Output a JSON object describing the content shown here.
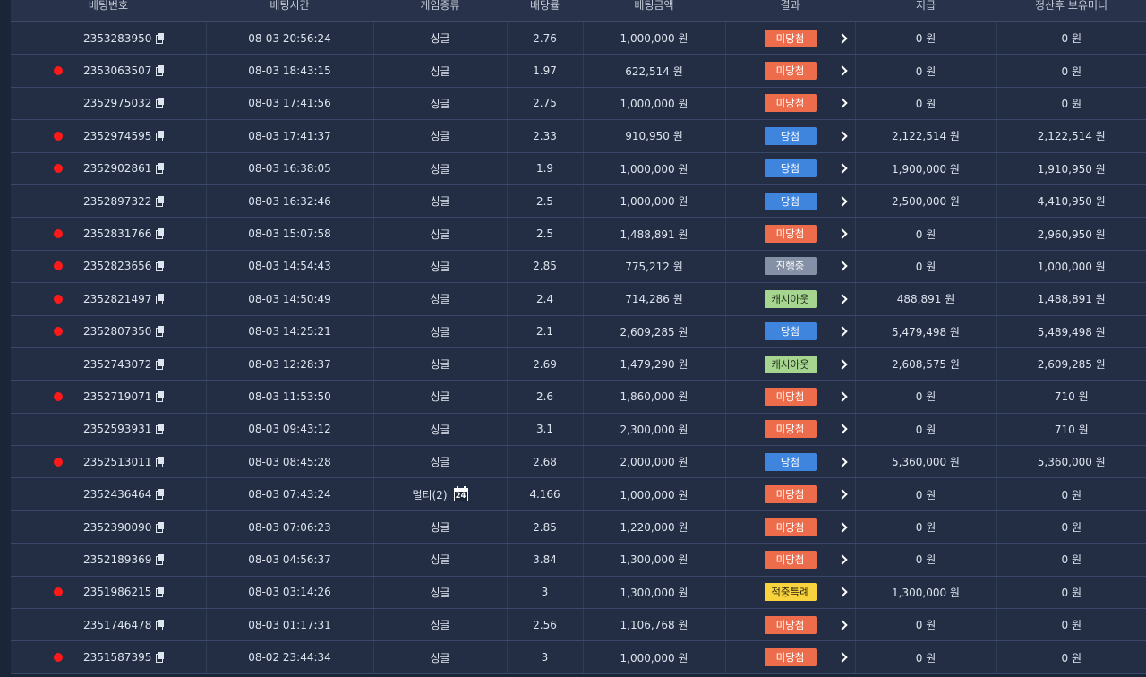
{
  "headers": [
    "베팅번호",
    "베팅시간",
    "게임종류",
    "배당률",
    "베팅금액",
    "결과",
    "지급",
    "정산후 보유머니"
  ],
  "rows": [
    {
      "id": "2353283950",
      "dot": false,
      "time": "08-03 20:56:24",
      "type": "싱글",
      "odds": "2.76",
      "amount": "1,000,000 원",
      "result": "미당첨",
      "rclass": "b-miss",
      "payout": "0 원",
      "balance": "0 원"
    },
    {
      "id": "2353063507",
      "dot": true,
      "time": "08-03 18:43:15",
      "type": "싱글",
      "odds": "1.97",
      "amount": "622,514 원",
      "result": "미당첨",
      "rclass": "b-miss",
      "payout": "0 원",
      "balance": "0 원"
    },
    {
      "id": "2352975032",
      "dot": false,
      "time": "08-03 17:41:56",
      "type": "싱글",
      "odds": "2.75",
      "amount": "1,000,000 원",
      "result": "미당첨",
      "rclass": "b-miss",
      "payout": "0 원",
      "balance": "0 원"
    },
    {
      "id": "2352974595",
      "dot": true,
      "time": "08-03 17:41:37",
      "type": "싱글",
      "odds": "2.33",
      "amount": "910,950 원",
      "result": "당첨",
      "rclass": "b-win",
      "payout": "2,122,514 원",
      "balance": "2,122,514 원"
    },
    {
      "id": "2352902861",
      "dot": true,
      "time": "08-03 16:38:05",
      "type": "싱글",
      "odds": "1.9",
      "amount": "1,000,000 원",
      "result": "당첨",
      "rclass": "b-win",
      "payout": "1,900,000 원",
      "balance": "1,910,950 원"
    },
    {
      "id": "2352897322",
      "dot": false,
      "time": "08-03 16:32:46",
      "type": "싱글",
      "odds": "2.5",
      "amount": "1,000,000 원",
      "result": "당첨",
      "rclass": "b-win",
      "payout": "2,500,000 원",
      "balance": "4,410,950 원"
    },
    {
      "id": "2352831766",
      "dot": true,
      "time": "08-03 15:07:58",
      "type": "싱글",
      "odds": "2.5",
      "amount": "1,488,891 원",
      "result": "미당첨",
      "rclass": "b-miss",
      "payout": "0 원",
      "balance": "2,960,950 원"
    },
    {
      "id": "2352823656",
      "dot": true,
      "time": "08-03 14:54:43",
      "type": "싱글",
      "odds": "2.85",
      "amount": "775,212 원",
      "result": "진행중",
      "rclass": "b-prog",
      "payout": "0 원",
      "balance": "1,000,000 원"
    },
    {
      "id": "2352821497",
      "dot": true,
      "time": "08-03 14:50:49",
      "type": "싱글",
      "odds": "2.4",
      "amount": "714,286 원",
      "result": "캐시아웃",
      "rclass": "b-cash",
      "payout": "488,891 원",
      "balance": "1,488,891 원"
    },
    {
      "id": "2352807350",
      "dot": true,
      "time": "08-03 14:25:21",
      "type": "싱글",
      "odds": "2.1",
      "amount": "2,609,285 원",
      "result": "당첨",
      "rclass": "b-win",
      "payout": "5,479,498 원",
      "balance": "5,489,498 원"
    },
    {
      "id": "2352743072",
      "dot": false,
      "time": "08-03 12:28:37",
      "type": "싱글",
      "odds": "2.69",
      "amount": "1,479,290 원",
      "result": "캐시아웃",
      "rclass": "b-cash",
      "payout": "2,608,575 원",
      "balance": "2,609,285 원"
    },
    {
      "id": "2352719071",
      "dot": true,
      "time": "08-03 11:53:50",
      "type": "싱글",
      "odds": "2.6",
      "amount": "1,860,000 원",
      "result": "미당첨",
      "rclass": "b-miss",
      "payout": "0 원",
      "balance": "710 원"
    },
    {
      "id": "2352593931",
      "dot": false,
      "time": "08-03 09:43:12",
      "type": "싱글",
      "odds": "3.1",
      "amount": "2,300,000 원",
      "result": "미당첨",
      "rclass": "b-miss",
      "payout": "0 원",
      "balance": "710 원"
    },
    {
      "id": "2352513011",
      "dot": true,
      "time": "08-03 08:45:28",
      "type": "싱글",
      "odds": "2.68",
      "amount": "2,000,000 원",
      "result": "당첨",
      "rclass": "b-win",
      "payout": "5,360,000 원",
      "balance": "5,360,000 원"
    },
    {
      "id": "2352436464",
      "dot": false,
      "time": "08-03 07:43:24",
      "type": "멀티(2)",
      "multi": true,
      "cal": "24",
      "odds": "4.166",
      "amount": "1,000,000 원",
      "result": "미당첨",
      "rclass": "b-miss",
      "payout": "0 원",
      "balance": "0 원"
    },
    {
      "id": "2352390090",
      "dot": false,
      "time": "08-03 07:06:23",
      "type": "싱글",
      "odds": "2.85",
      "amount": "1,220,000 원",
      "result": "미당첨",
      "rclass": "b-miss",
      "payout": "0 원",
      "balance": "0 원"
    },
    {
      "id": "2352189369",
      "dot": false,
      "time": "08-03 04:56:37",
      "type": "싱글",
      "odds": "3.84",
      "amount": "1,300,000 원",
      "result": "미당첨",
      "rclass": "b-miss",
      "payout": "0 원",
      "balance": "0 원"
    },
    {
      "id": "2351986215",
      "dot": true,
      "time": "08-03 03:14:26",
      "type": "싱글",
      "odds": "3",
      "amount": "1,300,000 원",
      "result": "적중특례",
      "rclass": "b-special",
      "payout": "1,300,000 원",
      "balance": "0 원"
    },
    {
      "id": "2351746478",
      "dot": false,
      "time": "08-03 01:17:31",
      "type": "싱글",
      "odds": "2.56",
      "amount": "1,106,768 원",
      "result": "미당첨",
      "rclass": "b-miss",
      "payout": "0 원",
      "balance": "0 원"
    },
    {
      "id": "2351587395",
      "dot": true,
      "time": "08-02 23:44:34",
      "type": "싱글",
      "odds": "3",
      "amount": "1,000,000 원",
      "result": "미당첨",
      "rclass": "b-miss",
      "payout": "0 원",
      "balance": "0 원"
    }
  ],
  "colors": {
    "miss": "#ec6c4c",
    "win": "#3f85de",
    "progress": "#8390a5",
    "cashout": "#a6d58f",
    "special": "#f8d33d",
    "dot": "#ff1a1a"
  },
  "icons": {
    "copy": "copy-icon",
    "detail": "chevron-right-icon",
    "multi": "calendar-icon"
  }
}
